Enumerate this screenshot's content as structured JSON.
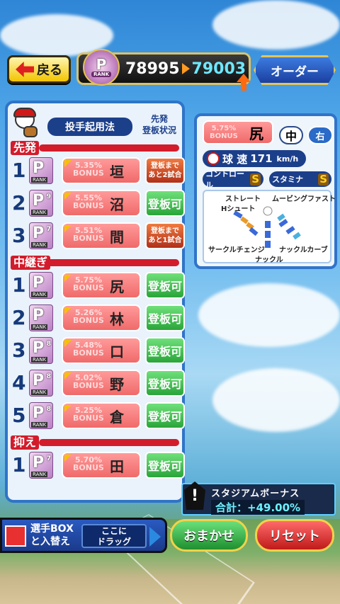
{
  "colors": {
    "accent_red": "#d21c2c",
    "panel_border": "#2f74c8",
    "ok_green": "#2aa53a"
  },
  "topbar": {
    "back_label": "戻る",
    "rank_letter": "P",
    "rank_label": "RANK",
    "rank_current": "78995",
    "rank_next": "79003",
    "order_label": "オーダー"
  },
  "panel": {
    "title": "投手起用法",
    "status_header": [
      "先発",
      "登板状況"
    ],
    "sections": {
      "starter": "先発",
      "relief": "中継ぎ",
      "closer": "抑え"
    }
  },
  "starters": [
    {
      "num": "1",
      "grade": "P",
      "level": "",
      "bonus": "5.35%",
      "name": "垣",
      "status": [
        "登板まで",
        "あと2試合"
      ],
      "ok": false
    },
    {
      "num": "2",
      "grade": "P",
      "level": "9",
      "bonus": "5.55%",
      "name": "沼",
      "status": [
        "登板可"
      ],
      "ok": true
    },
    {
      "num": "3",
      "grade": "P",
      "level": "7",
      "bonus": "5.51%",
      "name": "間",
      "status": [
        "登板まで",
        "あと1試合"
      ],
      "ok": false
    }
  ],
  "relievers": [
    {
      "num": "1",
      "grade": "P",
      "level": "",
      "bonus": "5.75%",
      "name": "尻",
      "status": [
        "登板可"
      ],
      "ok": true
    },
    {
      "num": "2",
      "grade": "P",
      "level": "",
      "bonus": "5.26%",
      "name": "林",
      "status": [
        "登板可"
      ],
      "ok": true
    },
    {
      "num": "3",
      "grade": "P",
      "level": "8",
      "bonus": "5.48%",
      "name": "口",
      "status": [
        "登板可"
      ],
      "ok": true
    },
    {
      "num": "4",
      "grade": "P",
      "level": "8",
      "bonus": "5.02%",
      "name": "野",
      "status": [
        "登板可"
      ],
      "ok": true
    },
    {
      "num": "5",
      "grade": "P",
      "level": "8",
      "bonus": "5.25%",
      "name": "倉",
      "status": [
        "登板可"
      ],
      "ok": true
    }
  ],
  "closer": [
    {
      "num": "1",
      "grade": "P",
      "level": "7",
      "bonus": "5.70%",
      "name": "田",
      "status": [
        "登板可"
      ],
      "ok": true
    }
  ],
  "detail": {
    "bonus": "5.75%",
    "name": "尻",
    "position": "中",
    "hand": "右",
    "speed_label": "球 速",
    "speed": "171",
    "speed_unit": "km/h",
    "control_label": "コントロール",
    "control_grade": "S",
    "stamina_label": "スタミナ",
    "stamina_grade": "S",
    "pitches": {
      "straight": "ストレート",
      "moving_fast": "ムービングファスト",
      "hshoot": "Hシュート",
      "circle_change": "サークルチェンジ",
      "knuckle_curve": "ナックルカーブ",
      "knuckle": "ナックル"
    }
  },
  "stadium": {
    "title": "スタジアムボーナス",
    "total": "合計：+49.00%"
  },
  "bottom": {
    "box_line1": "選手BOX",
    "box_line2": "と入替え",
    "drag_line1": "ここに",
    "drag_line2": "ドラッグ",
    "auto_label": "おまかせ",
    "reset_label": "リセット"
  }
}
